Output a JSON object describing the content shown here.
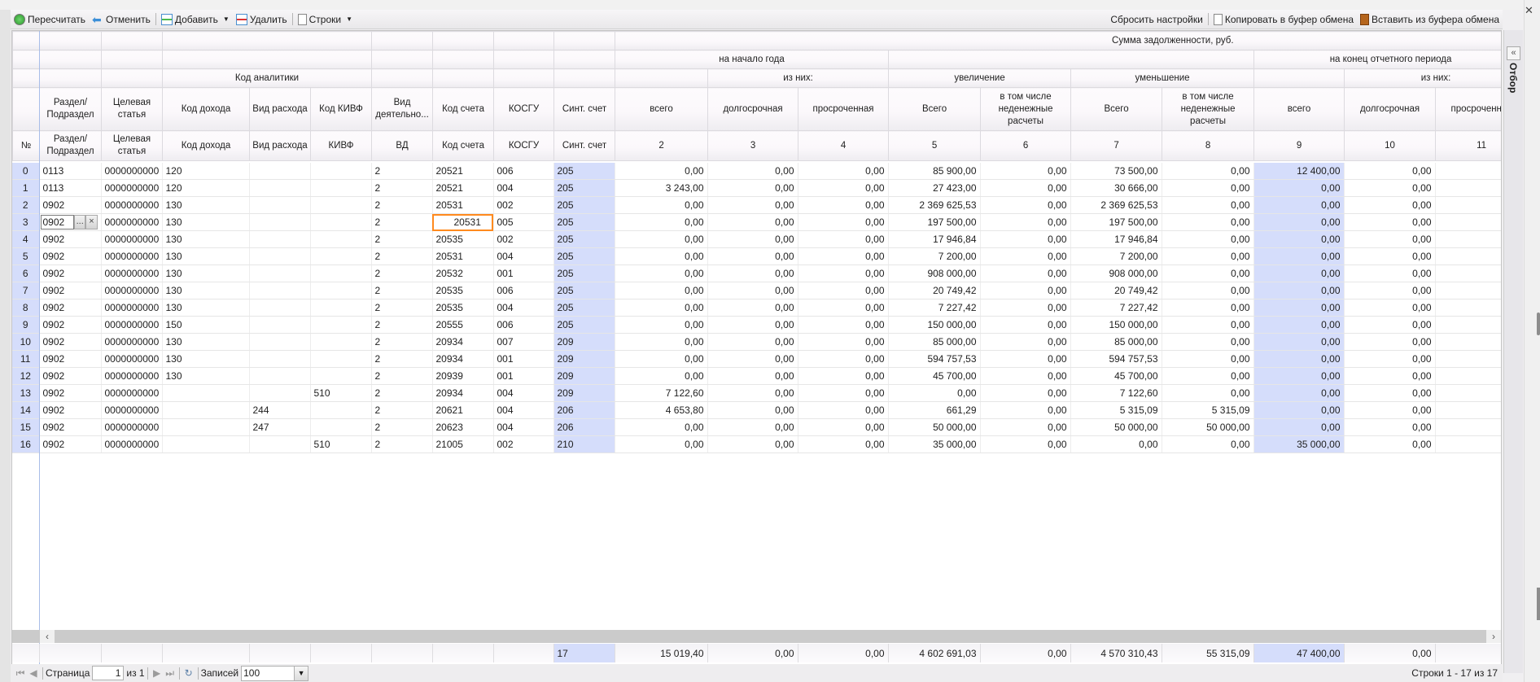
{
  "toolbar": {
    "recalc": "Пересчитать",
    "undo": "Отменить",
    "add": "Добавить",
    "delete": "Удалить",
    "rows": "Строки",
    "reset": "Сбросить настройки",
    "copy": "Копировать в буфер обмена",
    "paste": "Вставить из буфера обмена"
  },
  "header": {
    "group_analytics": "Код аналитики",
    "sum_title": "Сумма задолженности, руб.",
    "start_year": "на начало года",
    "end_period": "на конец отчетного периода",
    "of_them": "из них:",
    "increase": "увеличение",
    "decrease": "уменьшение",
    "titles": [
      "",
      "Раздел/ Подраздел",
      "Целевая статья",
      "Код дохода",
      "Вид расхода",
      "Код КИВФ",
      "Вид деятельно...",
      "Код счета",
      "КОСГУ",
      "Синт. счет",
      "всего",
      "долгосрочная",
      "просроченная",
      "Всего",
      "в том числе неденежные расчеты",
      "Всего",
      "в том числе неденежные расчеты",
      "всего",
      "долгосрочная",
      "просроченная"
    ],
    "codes": [
      "№",
      "Раздел/ Подраздел",
      "Целевая статья",
      "Код дохода",
      "Вид расхода",
      "КИВФ",
      "ВД",
      "Код счета",
      "КОСГУ",
      "Синт. счет",
      "2",
      "3",
      "4",
      "5",
      "6",
      "7",
      "8",
      "9",
      "10",
      "11"
    ]
  },
  "rows": [
    [
      "0",
      "0113",
      "0000000000",
      "120",
      "",
      "",
      "2",
      "20521",
      "006",
      "205",
      "0,00",
      "0,00",
      "0,00",
      "85 900,00",
      "0,00",
      "73 500,00",
      "0,00",
      "12 400,00",
      "0,00",
      ""
    ],
    [
      "1",
      "0113",
      "0000000000",
      "120",
      "",
      "",
      "2",
      "20521",
      "004",
      "205",
      "3 243,00",
      "0,00",
      "0,00",
      "27 423,00",
      "0,00",
      "30 666,00",
      "0,00",
      "0,00",
      "0,00",
      ""
    ],
    [
      "2",
      "0902",
      "0000000000",
      "130",
      "",
      "",
      "2",
      "20531",
      "002",
      "205",
      "0,00",
      "0,00",
      "0,00",
      "2 369 625,53",
      "0,00",
      "2 369 625,53",
      "0,00",
      "0,00",
      "0,00",
      ""
    ],
    [
      "3",
      "0902",
      "0000000000",
      "130",
      "",
      "",
      "2",
      "20531",
      "005",
      "205",
      "0,00",
      "0,00",
      "0,00",
      "197 500,00",
      "0,00",
      "197 500,00",
      "0,00",
      "0,00",
      "0,00",
      ""
    ],
    [
      "4",
      "0902",
      "0000000000",
      "130",
      "",
      "",
      "2",
      "20535",
      "002",
      "205",
      "0,00",
      "0,00",
      "0,00",
      "17 946,84",
      "0,00",
      "17 946,84",
      "0,00",
      "0,00",
      "0,00",
      ""
    ],
    [
      "5",
      "0902",
      "0000000000",
      "130",
      "",
      "",
      "2",
      "20531",
      "004",
      "205",
      "0,00",
      "0,00",
      "0,00",
      "7 200,00",
      "0,00",
      "7 200,00",
      "0,00",
      "0,00",
      "0,00",
      ""
    ],
    [
      "6",
      "0902",
      "0000000000",
      "130",
      "",
      "",
      "2",
      "20532",
      "001",
      "205",
      "0,00",
      "0,00",
      "0,00",
      "908 000,00",
      "0,00",
      "908 000,00",
      "0,00",
      "0,00",
      "0,00",
      ""
    ],
    [
      "7",
      "0902",
      "0000000000",
      "130",
      "",
      "",
      "2",
      "20535",
      "006",
      "205",
      "0,00",
      "0,00",
      "0,00",
      "20 749,42",
      "0,00",
      "20 749,42",
      "0,00",
      "0,00",
      "0,00",
      ""
    ],
    [
      "8",
      "0902",
      "0000000000",
      "130",
      "",
      "",
      "2",
      "20535",
      "004",
      "205",
      "0,00",
      "0,00",
      "0,00",
      "7 227,42",
      "0,00",
      "7 227,42",
      "0,00",
      "0,00",
      "0,00",
      ""
    ],
    [
      "9",
      "0902",
      "0000000000",
      "150",
      "",
      "",
      "2",
      "20555",
      "006",
      "205",
      "0,00",
      "0,00",
      "0,00",
      "150 000,00",
      "0,00",
      "150 000,00",
      "0,00",
      "0,00",
      "0,00",
      ""
    ],
    [
      "10",
      "0902",
      "0000000000",
      "130",
      "",
      "",
      "2",
      "20934",
      "007",
      "209",
      "0,00",
      "0,00",
      "0,00",
      "85 000,00",
      "0,00",
      "85 000,00",
      "0,00",
      "0,00",
      "0,00",
      ""
    ],
    [
      "11",
      "0902",
      "0000000000",
      "130",
      "",
      "",
      "2",
      "20934",
      "001",
      "209",
      "0,00",
      "0,00",
      "0,00",
      "594 757,53",
      "0,00",
      "594 757,53",
      "0,00",
      "0,00",
      "0,00",
      ""
    ],
    [
      "12",
      "0902",
      "0000000000",
      "130",
      "",
      "",
      "2",
      "20939",
      "001",
      "209",
      "0,00",
      "0,00",
      "0,00",
      "45 700,00",
      "0,00",
      "45 700,00",
      "0,00",
      "0,00",
      "0,00",
      ""
    ],
    [
      "13",
      "0902",
      "0000000000",
      "",
      "",
      "510",
      "2",
      "20934",
      "004",
      "209",
      "7 122,60",
      "0,00",
      "0,00",
      "0,00",
      "0,00",
      "7 122,60",
      "0,00",
      "0,00",
      "0,00",
      ""
    ],
    [
      "14",
      "0902",
      "0000000000",
      "",
      "244",
      "",
      "2",
      "20621",
      "004",
      "206",
      "4 653,80",
      "0,00",
      "0,00",
      "661,29",
      "0,00",
      "5 315,09",
      "5 315,09",
      "0,00",
      "0,00",
      ""
    ],
    [
      "15",
      "0902",
      "0000000000",
      "",
      "247",
      "",
      "2",
      "20623",
      "004",
      "206",
      "0,00",
      "0,00",
      "0,00",
      "50 000,00",
      "0,00",
      "50 000,00",
      "50 000,00",
      "0,00",
      "0,00",
      ""
    ],
    [
      "16",
      "0902",
      "0000000000",
      "",
      "",
      "510",
      "2",
      "21005",
      "002",
      "210",
      "0,00",
      "0,00",
      "0,00",
      "35 000,00",
      "0,00",
      "0,00",
      "0,00",
      "35 000,00",
      "0,00",
      ""
    ]
  ],
  "editing": {
    "row": 3,
    "value": "0902",
    "browse": "...",
    "clear": "×"
  },
  "focused_cell": {
    "row": 3,
    "column": "Код счета"
  },
  "totals": [
    "",
    "",
    "",
    "",
    "",
    "",
    "",
    "",
    "",
    "17",
    "15 019,40",
    "0,00",
    "0,00",
    "4 602 691,03",
    "0,00",
    "4 570 310,43",
    "55 315,09",
    "47 400,00",
    "0,00",
    ""
  ],
  "pager": {
    "page_label": "Страница",
    "page": "1",
    "of": "из 1",
    "records_label": "Записей",
    "records": "100",
    "info": "Строки 1 - 17 из 17"
  },
  "side_panel": {
    "title": "Отбор",
    "expand": "«"
  },
  "colors": {
    "highlight": "#d5ddfb",
    "focus": "#ff8a1e",
    "selection_line": "#a8bde8"
  }
}
